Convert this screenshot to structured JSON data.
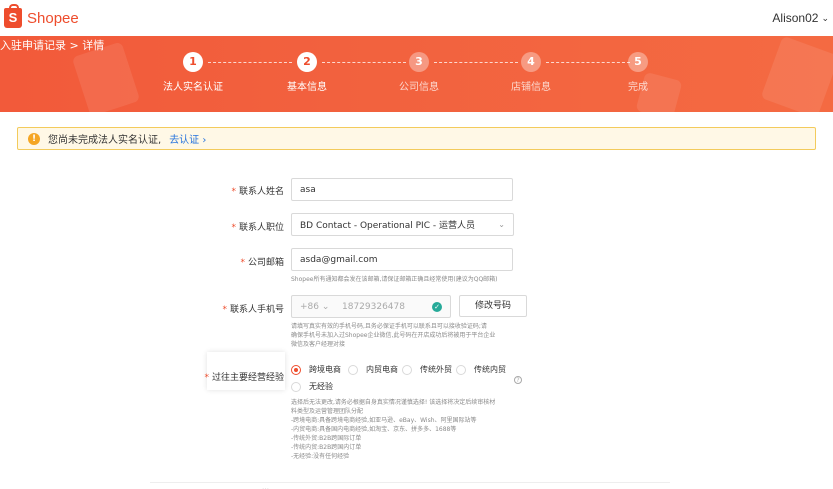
{
  "header": {
    "logo_text": "Shopee",
    "logo_glyph": "S",
    "user_name": "Alison02",
    "user_chevron": "⌄"
  },
  "banner": {
    "breadcrumb": "入驻申请记录 > 详情",
    "steps": [
      {
        "num": "1",
        "label": "法人实名认证",
        "state": "active"
      },
      {
        "num": "2",
        "label": "基本信息",
        "state": "active"
      },
      {
        "num": "3",
        "label": "公司信息",
        "state": "inactive"
      },
      {
        "num": "4",
        "label": "店铺信息",
        "state": "inactive"
      },
      {
        "num": "5",
        "label": "完成",
        "state": "inactive"
      }
    ]
  },
  "alert": {
    "icon": "!",
    "message": "您尚未完成法人实名认证,",
    "link": "去认证 ›"
  },
  "form": {
    "contact_name": {
      "label": "联系人姓名",
      "value": "asa"
    },
    "contact_position": {
      "label": "联系人职位",
      "value": "BD Contact - Operational PIC - 运营人员",
      "chevron": "⌄"
    },
    "company_email": {
      "label": "公司邮箱",
      "value": "asda@gmail.com",
      "help": "Shopee所有通知都会发在该邮箱,请保证邮箱正确且经常使用(建议为QQ邮箱)"
    },
    "contact_phone": {
      "label": "联系人手机号",
      "country_code": "+86",
      "code_chevron": "⌄",
      "value": "18729326478",
      "verified_icon": "✓",
      "change_button": "修改号码",
      "help": [
        "请填写真实有效的手机号码,且务必保证手机可以联系且可以接收验证码;请",
        "确保手机号未加入过Shopee企业微信,此号码在开店成功后将被用于平台企业",
        "微信及客户经理对接"
      ]
    },
    "experience": {
      "label": "过往主要经营经验",
      "options": [
        "跨境电商",
        "内贸电商",
        "传统外贸",
        "传统内贸",
        "无经验"
      ],
      "selected": "跨境电商",
      "help_icon": "?",
      "help": [
        "选择后无法更改,请务必根据自身真实情况谨慎选择! 该选择将决定后续审核材",
        "料类型及运营管理团队分配",
        "-跨境电商:具备跨境电商经验,如亚马逊、eBay、Wish、阿里国际站等",
        "-内贸电商:具备国内电商经验,如淘宝、京东、拼多多、1688等",
        "-传统外贸:B2B跨国际订单",
        "-传统内贸:B2B跨国内订单",
        "-无经验:没有任何经验"
      ]
    }
  },
  "footer": {
    "text": "…"
  },
  "colors": {
    "brand": "#ee4d2d",
    "link": "#2673dd",
    "warn": "#f5a623",
    "success": "#26aa99"
  }
}
